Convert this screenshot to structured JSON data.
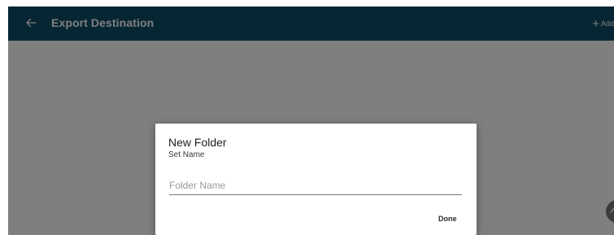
{
  "appbar": {
    "title": "Export Destination",
    "add_label": "Add",
    "add_icon": "+",
    "back_icon": "arrow-back-icon",
    "background_color": "#0d4d66"
  },
  "dialog": {
    "title": "New Folder",
    "subtitle": "Set Name",
    "folder_input": {
      "placeholder": "Folder Name",
      "value": ""
    },
    "done_label": "Done"
  },
  "fab": {
    "icon": "chevron-up-icon"
  },
  "colors": {
    "appbar": "#0d4d66",
    "overlay": "rgba(0,0,0,0.5)",
    "dialog_background": "#ffffff"
  }
}
